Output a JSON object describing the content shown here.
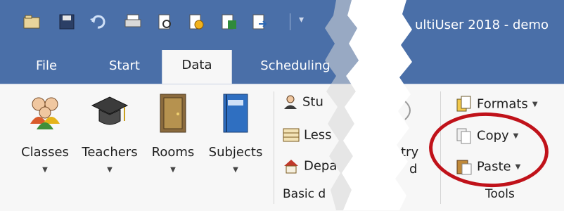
{
  "window": {
    "title": "ultiUser 2018 - demo"
  },
  "tabs": [
    {
      "label": "File",
      "active": false
    },
    {
      "label": "Start",
      "active": false
    },
    {
      "label": "Data",
      "active": true
    },
    {
      "label": "Scheduling",
      "active": false
    }
  ],
  "ribbon": {
    "basic_data_group": {
      "buttons": [
        {
          "label": "Classes",
          "icon": "people-group-icon"
        },
        {
          "label": "Teachers",
          "icon": "graduation-cap-icon"
        },
        {
          "label": "Rooms",
          "icon": "door-icon"
        },
        {
          "label": "Subjects",
          "icon": "book-icon"
        }
      ],
      "small_items": [
        {
          "label": "Stu",
          "icon": "student-icon"
        },
        {
          "label": "Less",
          "icon": "lessons-icon"
        },
        {
          "label": "Depa",
          "icon": "department-icon"
        }
      ],
      "label": "Basic d"
    },
    "partial_right": {
      "line1": "try",
      "line2": "d"
    },
    "tools_group": {
      "items": [
        {
          "label": "Formats",
          "icon": "formats-icon"
        },
        {
          "label": "Copy",
          "icon": "copy-icon"
        },
        {
          "label": "Paste",
          "icon": "paste-icon"
        }
      ],
      "label": "Tools"
    }
  },
  "colors": {
    "titlebar": "#4a6fa8",
    "ribbon": "#f7f7f7",
    "highlight": "#c0121a"
  }
}
